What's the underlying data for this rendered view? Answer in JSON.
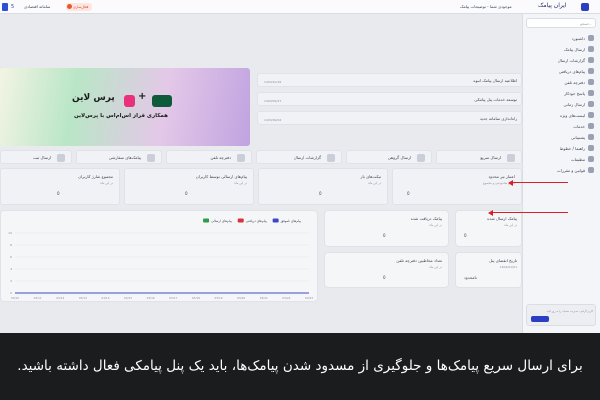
{
  "topbar": {
    "logo_text": "ایران پیامک",
    "center_text": "موجودی شما - توضیحات پیامک",
    "left_button": "فعال‌سازی",
    "left_info": "سامانه اقتصادی",
    "counter": "5"
  },
  "sidebar": {
    "search_placeholder": "جستجو...",
    "items": [
      {
        "label": "داشبورد"
      },
      {
        "label": "ارسال پیامک"
      },
      {
        "label": "گزارشات ارسال"
      },
      {
        "label": "پیام‌های دریافتی"
      },
      {
        "label": "دفترچه تلفن"
      },
      {
        "label": "پاسخ خودکار"
      },
      {
        "label": "ارسال زمانی"
      },
      {
        "label": "لیست‌های ویژه"
      },
      {
        "label": "خدمات"
      },
      {
        "label": "پشتیبانی"
      },
      {
        "label": "راهنما / خطوط"
      },
      {
        "label": "تنظیمات"
      },
      {
        "label": "قوانین و مقررات"
      }
    ],
    "footer": "کاربر گرامی، مدیریت حساب را به روز کنید"
  },
  "notices": [
    {
      "text": "اطلاعیه ارسال پیامک انبوه",
      "date": "1403/10/16"
    },
    {
      "text": "توسعه خدمات پنل پیامکی",
      "date": "1403/09/27"
    },
    {
      "text": "راه‌اندازی سامانه جدید",
      "date": "1403/09/02"
    }
  ],
  "banner": {
    "title": "پرس لاین",
    "subtitle": "همکاری فراز اس‌ام‌اس با پرس‌لاین"
  },
  "quick_actions": [
    {
      "label": "ارسال سریع"
    },
    {
      "label": "ارسال گروهی"
    },
    {
      "label": "گزارشات ارسال"
    },
    {
      "label": "دفترچه تلفن"
    },
    {
      "label": "پیامک‌های سفارشی"
    },
    {
      "label": "ارسال ثبت"
    }
  ],
  "stats_row1": [
    {
      "title": "اعتبار تیر محدود",
      "sub": "اعتبار محدودیتی و مجموع",
      "value": "0"
    },
    {
      "title": "تیکت‌های باز",
      "sub": "در این ماه",
      "value": "0"
    },
    {
      "title": "پیام‌های ارسالی توسط کاربران",
      "sub": "در این ماه",
      "value": "0"
    },
    {
      "title": "مجموع شارژ کاربران",
      "sub": "در این ماه",
      "value": "0"
    }
  ],
  "stats_side": [
    {
      "title": "پیامک ارسال شده",
      "sub": "در این ماه",
      "value": "0"
    },
    {
      "title": "پیامک دریافت شده",
      "sub": "در این ماه",
      "value": "0"
    },
    {
      "title": "تعداد مخاطبین دفترچه تلفن",
      "sub": "در این ماه",
      "value": "0"
    },
    {
      "title": "تاریخ انقضای پنل",
      "sub": "1404/01/01",
      "value": "نامحدود"
    }
  ],
  "chart": {
    "legend": [
      "پیام‌های ارسالی",
      "پیام‌های دریافتی",
      "پیام‌های ناموفق"
    ],
    "legend_colors": [
      "#2e9b4a",
      "#d8323a",
      "#3b49c8"
    ],
    "x_ticks": [
      "03/10",
      "03/11",
      "03/12",
      "03/13",
      "03/14",
      "03/15",
      "03/16",
      "03/17",
      "03/18",
      "03/19",
      "03/20",
      "03/21",
      "03/22",
      "03/23"
    ],
    "y_ticks": [
      "10",
      "8",
      "6",
      "4",
      "2",
      "0"
    ]
  },
  "chart_data": {
    "type": "line",
    "x": [
      "03/10",
      "03/11",
      "03/12",
      "03/13",
      "03/14",
      "03/15",
      "03/16",
      "03/17",
      "03/18",
      "03/19",
      "03/20",
      "03/21",
      "03/22",
      "03/23"
    ],
    "series": [
      {
        "name": "پیام‌های ارسالی",
        "values": [
          0,
          0,
          0,
          0,
          0,
          0,
          0,
          0,
          0,
          0,
          0,
          0,
          0,
          0
        ]
      },
      {
        "name": "پیام‌های دریافتی",
        "values": [
          0,
          0,
          0,
          0,
          0,
          0,
          0,
          0,
          0,
          0,
          0,
          0,
          0,
          0
        ]
      },
      {
        "name": "پیام‌های ناموفق",
        "values": [
          0,
          0,
          0,
          0,
          0,
          0,
          0,
          0,
          0,
          0,
          0,
          0,
          0,
          0
        ]
      }
    ],
    "ylim": [
      0,
      10
    ]
  },
  "caption": "برای ارسال سریع پیامک‌ها و جلوگیری از مسدود شدن پیامک‌ها، باید یک پنل پیامکی فعال داشته باشید."
}
